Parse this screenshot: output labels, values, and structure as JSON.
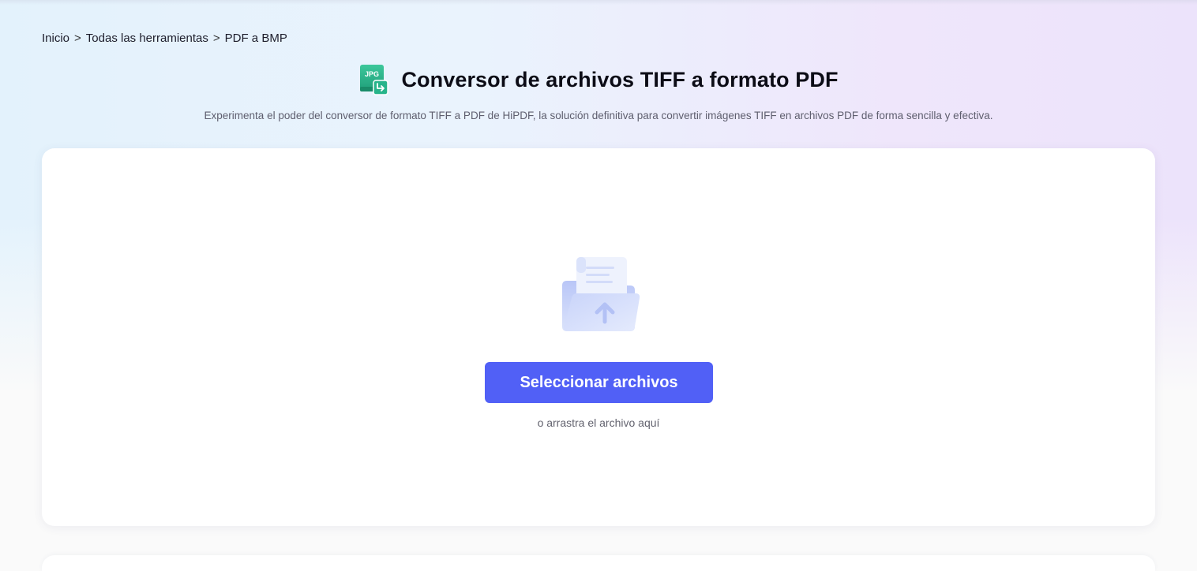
{
  "breadcrumb": {
    "items": [
      "Inicio",
      "Todas las herramientas",
      "PDF a BMP"
    ],
    "separator": ">"
  },
  "header": {
    "icon_label": "JPG",
    "title": "Conversor de archivos TIFF a formato PDF",
    "subtitle": "Experimenta el poder del conversor de formato TIFF a PDF de HiPDF, la solución definitiva para convertir imágenes TIFF en archivos PDF de forma sencilla y efectiva."
  },
  "upload": {
    "button_label": "Seleccionar archivos",
    "drag_hint": "o arrastra el archivo aquí"
  },
  "icons": {
    "tool": "jpg-convert-icon",
    "upload": "folder-upload-icon"
  },
  "colors": {
    "accent": "#5160f6",
    "icon_green": "#27b48a",
    "title": "#0c0c16"
  }
}
